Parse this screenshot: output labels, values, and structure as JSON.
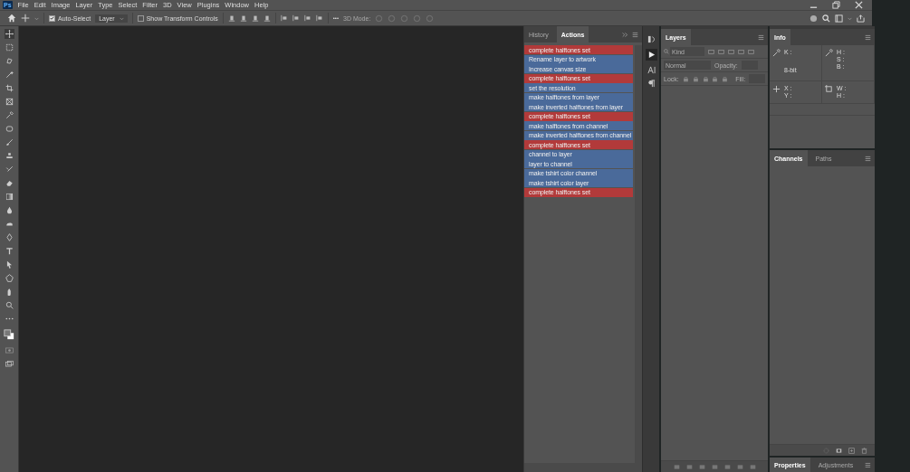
{
  "app_logo": "Ps",
  "menu": [
    "File",
    "Edit",
    "Image",
    "Layer",
    "Type",
    "Select",
    "Filter",
    "3D",
    "View",
    "Plugins",
    "Window",
    "Help"
  ],
  "options_bar": {
    "auto_select": {
      "label": "Auto-Select",
      "checked": true
    },
    "target_dropdown": "Layer",
    "show_transform": {
      "label": "Show Transform Controls",
      "checked": false
    },
    "more": "•••",
    "mode_3d": "3D Mode:"
  },
  "actions_panel": {
    "tabs": [
      {
        "label": "History",
        "selected": false
      },
      {
        "label": "Actions",
        "selected": true
      }
    ],
    "items": [
      {
        "label": "complete halftones set",
        "color": "#b23a3a"
      },
      {
        "label": "Rename layer to artwork",
        "color": "#4a6a9a"
      },
      {
        "label": "Increase canvas size",
        "color": "#4a6a9a"
      },
      {
        "label": "complete halftones set",
        "color": "#b23a3a"
      },
      {
        "label": "set the resolution",
        "color": "#4a6a9a"
      },
      {
        "label": "make halftones from layer",
        "color": "#4a6a9a"
      },
      {
        "label": "make inverted halftones from layer",
        "color": "#4a6a9a"
      },
      {
        "label": "complete halftones set",
        "color": "#b23a3a"
      },
      {
        "label": "make halftones from channel",
        "color": "#4a6a9a"
      },
      {
        "label": "make inverted halftones from channel",
        "color": "#4a6a9a"
      },
      {
        "label": "complete halftones set",
        "color": "#b23a3a"
      },
      {
        "label": "channel to layer",
        "color": "#4a6a9a"
      },
      {
        "label": "layer to channel",
        "color": "#4a6a9a"
      },
      {
        "label": "make tshirt color channel",
        "color": "#4a6a9a"
      },
      {
        "label": "make tshirt color layer",
        "color": "#4a6a9a"
      },
      {
        "label": "complete halftones set",
        "color": "#b23a3a"
      }
    ]
  },
  "layers_panel": {
    "tabs": [
      {
        "label": "Layers",
        "selected": true
      }
    ],
    "filter": {
      "placeholder": "Kind"
    },
    "blend_mode": "Normal",
    "opacity_label": "Opacity:",
    "lock_label": "Lock:",
    "fill_label": "Fill:"
  },
  "info_panel": {
    "tabs": [
      {
        "label": "Info",
        "selected": true
      }
    ],
    "color_left": [
      "K :"
    ],
    "color_right": [
      "H :",
      "S :",
      "B :"
    ],
    "bit_depth": "8-bit",
    "position": [
      "X :",
      "Y :"
    ],
    "size": [
      "W :",
      "H :"
    ]
  },
  "channels_panel": {
    "tabs": [
      {
        "label": "Channels",
        "selected": true
      },
      {
        "label": "Paths",
        "selected": false
      }
    ]
  },
  "properties_panel": {
    "tabs": [
      {
        "label": "Properties",
        "selected": true
      },
      {
        "label": "Adjustments",
        "selected": false
      }
    ]
  }
}
